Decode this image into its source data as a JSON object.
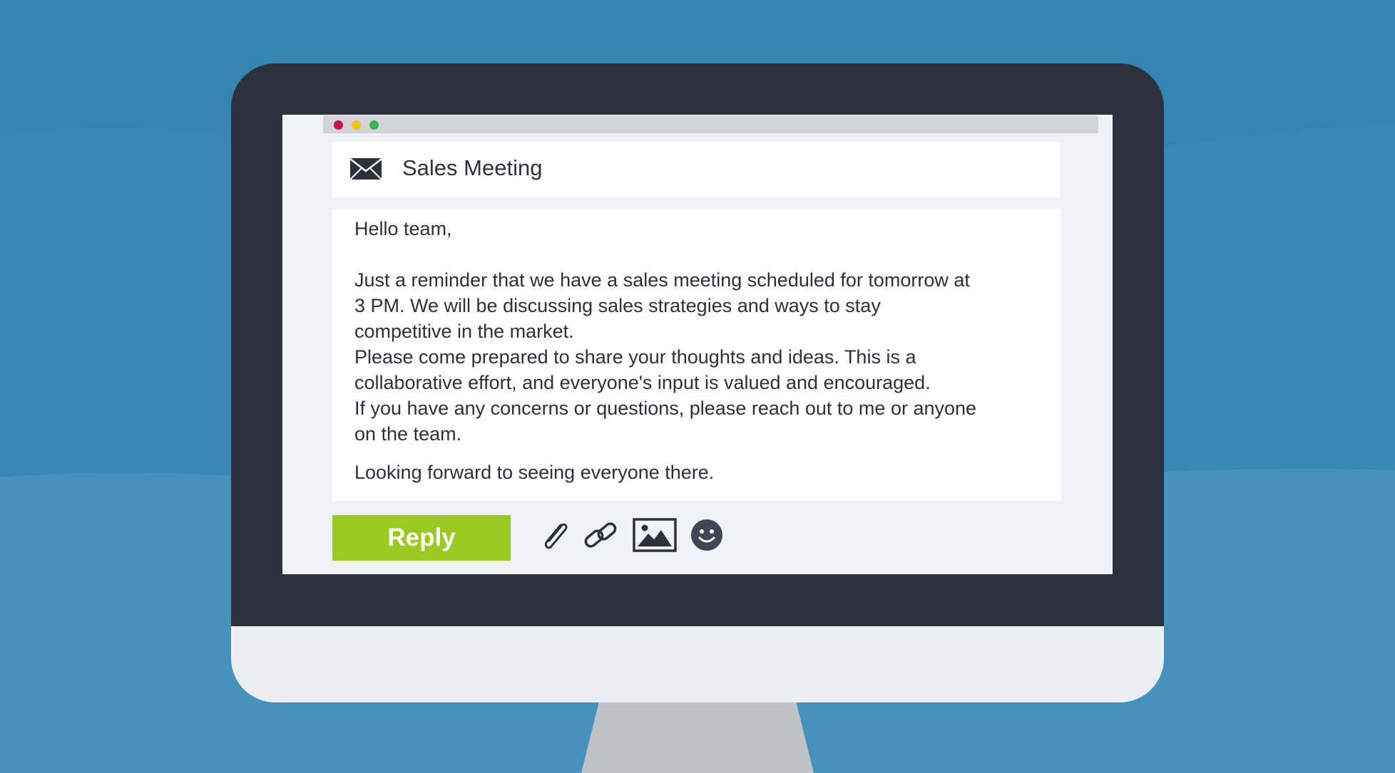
{
  "email": {
    "subject": "Sales Meeting",
    "greeting": "Hello team,",
    "body": "Just a reminder that we have a sales meeting scheduled for tomorrow at\n3 PM. We will be discussing sales strategies and ways to stay\ncompetitive in the market.\nPlease come prepared to share your thoughts and ideas. This is a\ncollaborative effort, and everyone's input is valued and encouraged.\nIf you have any concerns or questions, please reach out to me or anyone\non the team.",
    "closing": "Looking forward to seeing everyone there."
  },
  "toolbar": {
    "reply_label": "Reply",
    "icons": [
      "paperclip-icon",
      "link-icon",
      "image-icon",
      "emoji-icon"
    ]
  },
  "window_controls": [
    "close-dot",
    "minimize-dot",
    "maximize-dot"
  ],
  "colors": {
    "background": "#3486b1",
    "bezel": "#2b323b",
    "reply_button": "#9ac920",
    "screen": "#f1f2f8"
  }
}
